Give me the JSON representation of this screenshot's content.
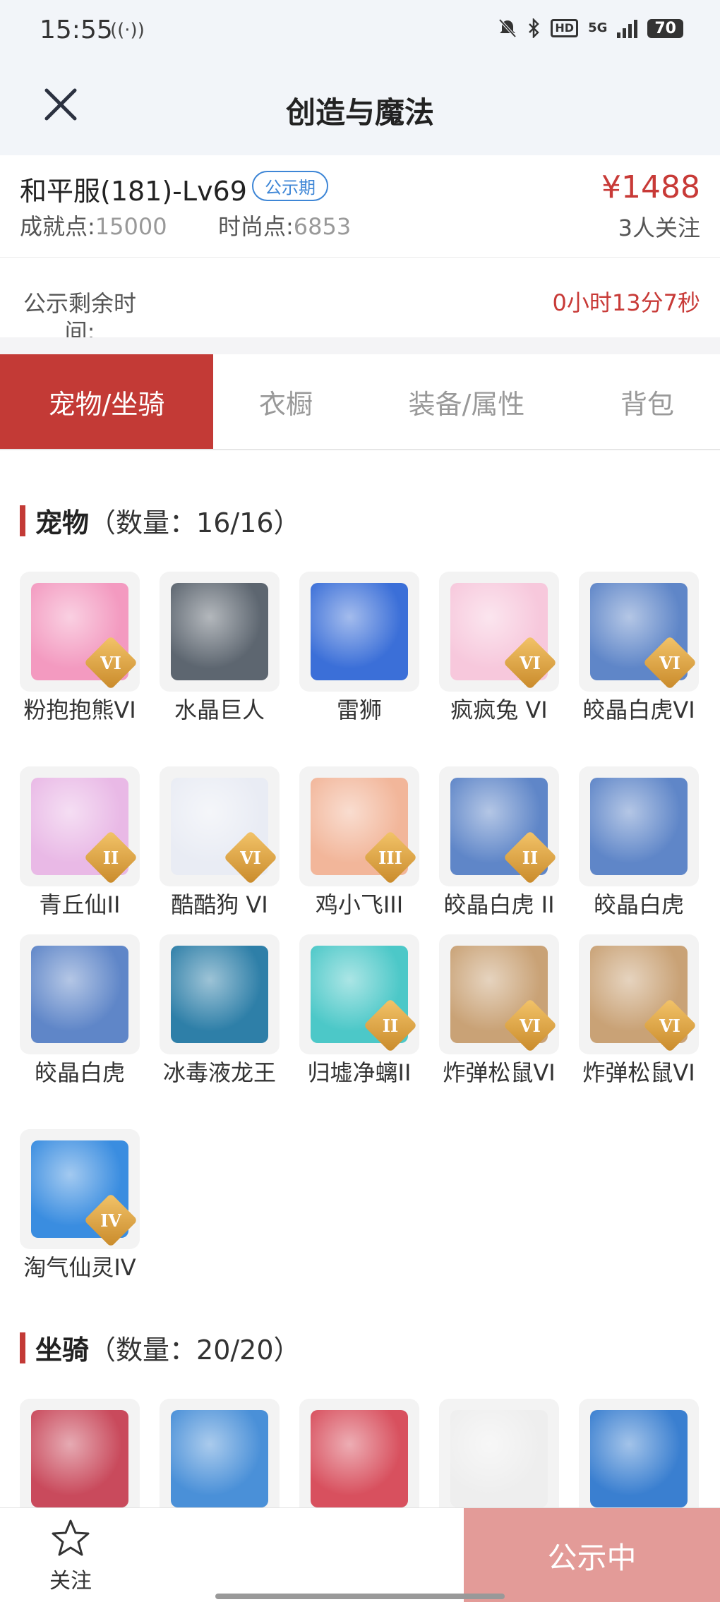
{
  "status_bar": {
    "time": "15:55",
    "battery": "70",
    "network": "5G"
  },
  "nav": {
    "title": "创造与魔法"
  },
  "listing": {
    "server": "和平服(181)-Lv69",
    "badge": "公示期",
    "achievement_label": "成就点:",
    "achievement_value": "15000",
    "fashion_label": "时尚点:",
    "fashion_value": "6853",
    "price": "¥1488",
    "followers": "3人关注",
    "remaining_label": "公示剩余时间:",
    "remaining_value": "0小时13分7秒"
  },
  "tabs": [
    {
      "label": "宠物/坐骑",
      "active": true
    },
    {
      "label": "衣橱",
      "active": false
    },
    {
      "label": "装备/属性",
      "active": false
    },
    {
      "label": "背包",
      "active": false
    }
  ],
  "pets_section": {
    "title": "宠物",
    "count": "（数量：16/16）"
  },
  "pets": [
    {
      "name": "粉抱抱熊VI",
      "rank": "VI",
      "icon": "pink-bear-icon",
      "color": "#f39ac0"
    },
    {
      "name": "水晶巨人",
      "rank": "",
      "icon": "crystal-giant-icon",
      "color": "#5d6670"
    },
    {
      "name": "雷狮",
      "rank": "",
      "icon": "thunder-lion-icon",
      "color": "#3b6fd8"
    },
    {
      "name": "疯疯兔 VI",
      "rank": "VI",
      "icon": "crazy-rabbit-icon",
      "color": "#f7c8dc"
    },
    {
      "name": "皎晶白虎VI",
      "rank": "VI",
      "icon": "white-tiger-icon",
      "color": "#5f86c8"
    },
    {
      "name": "青丘仙II",
      "rank": "II",
      "icon": "fox-fairy-icon",
      "color": "#e9b9e6"
    },
    {
      "name": "酷酷狗 VI",
      "rank": "VI",
      "icon": "cool-dog-icon",
      "color": "#e9ecf4"
    },
    {
      "name": "鸡小飞III",
      "rank": "III",
      "icon": "chick-icon",
      "color": "#f2b69a"
    },
    {
      "name": "皎晶白虎 II",
      "rank": "II",
      "icon": "white-tiger-icon",
      "color": "#5f86c8"
    },
    {
      "name": "皎晶白虎",
      "rank": "",
      "icon": "white-tiger-icon",
      "color": "#5f86c8"
    },
    {
      "name": "皎晶白虎",
      "rank": "",
      "icon": "white-tiger-icon",
      "color": "#5f86c8"
    },
    {
      "name": "冰毒液龙王",
      "rank": "",
      "icon": "venom-dragon-icon",
      "color": "#2e7fa8"
    },
    {
      "name": "归墟净螭II",
      "rank": "II",
      "icon": "water-dragon-icon",
      "color": "#4cc8c8"
    },
    {
      "name": "炸弹松鼠VI",
      "rank": "VI",
      "icon": "bomb-squirrel-icon",
      "color": "#c9a276"
    },
    {
      "name": "炸弹松鼠VI",
      "rank": "VI",
      "icon": "bomb-squirrel-icon",
      "color": "#c9a276"
    },
    {
      "name": "淘气仙灵IV",
      "rank": "IV",
      "icon": "naughty-sprite-icon",
      "color": "#3a8de0"
    }
  ],
  "mounts_section": {
    "title": "坐骑",
    "count": "（数量：20/20）"
  },
  "mounts": [
    {
      "icon": "red-dragon-icon",
      "color": "#c94a5c"
    },
    {
      "icon": "blue-dragon-icon",
      "color": "#4a90d8"
    },
    {
      "icon": "red-dino-icon",
      "color": "#d8505e"
    },
    {
      "icon": "white-fox-icon",
      "color": "#eeeeee"
    },
    {
      "icon": "blue-bird-icon",
      "color": "#3a7fd0"
    }
  ],
  "bottom": {
    "follow_label": "关注",
    "publish_label": "公示中"
  },
  "colors": {
    "accent": "#c33a36",
    "badge_blue": "#3e86d6",
    "publish_bg": "#e39b98"
  }
}
